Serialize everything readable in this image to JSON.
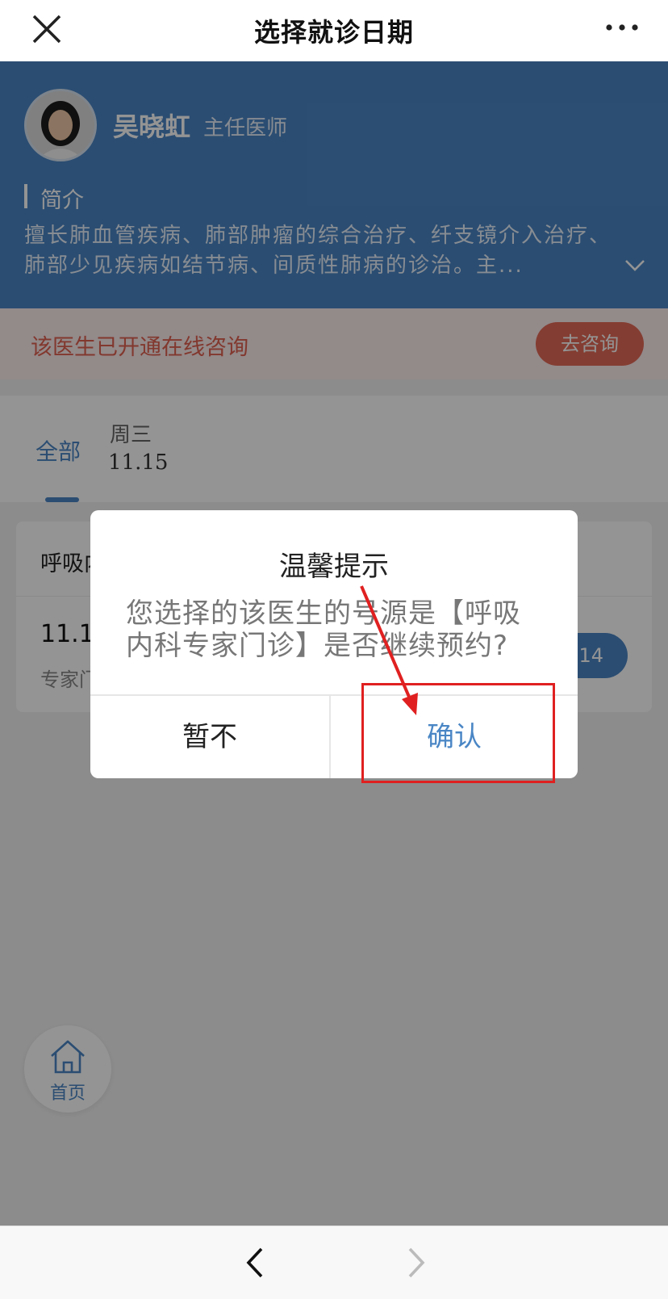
{
  "header": {
    "title": "选择就诊日期",
    "close_icon": "close-icon",
    "more_icon": "more-icon"
  },
  "doctor": {
    "name": "吴晓虹",
    "title": "主任医师",
    "intro_label": "简介",
    "intro_text": "擅长肺血管疾病、肺部肿瘤的综合治疗、纤支镜介入治疗、肺部少见疾病如结节病、间质性肺病的诊治。主..."
  },
  "consult": {
    "text": "该医生已开通在线咨询",
    "button_label": "去咨询"
  },
  "date_tabs": {
    "all_label": "全部",
    "days": [
      {
        "weekday": "周三",
        "date": "11.15"
      }
    ]
  },
  "schedule": {
    "department": "呼吸内科专家门诊",
    "slot_date": "11.15",
    "slot_type": "专家门诊",
    "slot_button": "14"
  },
  "fab": {
    "label": "首页",
    "icon": "home-icon"
  },
  "dialog": {
    "title": "温馨提示",
    "message": "您选择的该医生的号源是【呼吸内科专家门诊】是否继续预约?",
    "cancel_label": "暂不",
    "confirm_label": "确认"
  },
  "annotation": {
    "color": "#e02020"
  },
  "colors": {
    "accent": "#4a86c5",
    "consult_red": "#e36a57"
  },
  "bottom_nav": {
    "back_icon": "chevron-left-icon",
    "forward_icon": "chevron-right-icon"
  }
}
